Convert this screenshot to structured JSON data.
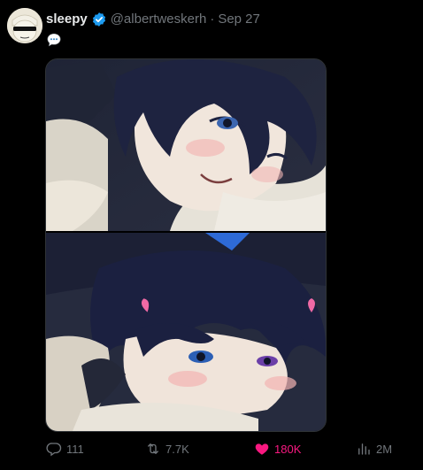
{
  "tweet": {
    "author": {
      "name": "sleepy",
      "handle": "@albertweskerh",
      "verified": true
    },
    "date_separator": "·",
    "date": "Sep 27",
    "text_emoji": "speech-balloon-icon",
    "media": {
      "image_count": 2
    },
    "actions": {
      "replies": "111",
      "retweets": "7.7K",
      "likes": "180K",
      "views": "2M"
    },
    "colors": {
      "verified": "#1d9bf0",
      "like_active": "#f91880",
      "muted": "#71767b"
    }
  }
}
